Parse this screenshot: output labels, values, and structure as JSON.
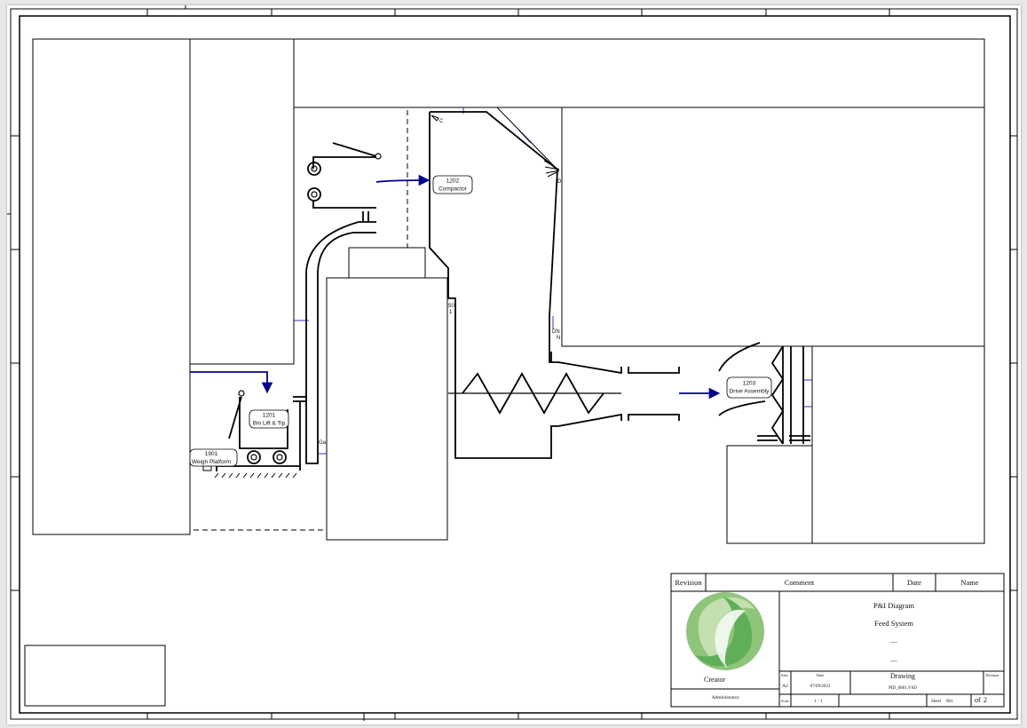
{
  "equipment": {
    "compactor": {
      "tag": "1202",
      "name": "Compactor"
    },
    "bin_lift": {
      "tag": "1201",
      "name": "Bin Lift & Tip"
    },
    "weigh_platform": {
      "tag": "1901",
      "name": "Weigh Platform"
    },
    "drive_assembly": {
      "tag": "1203",
      "name": "Drive Assembly"
    }
  },
  "fragments": {
    "frag_50": "50",
    "frag_1": "1",
    "frag_dn": "DN",
    "frag_n": "N",
    "frag_ga": "Ga",
    "frag_c": "C",
    "frag_d": "D"
  },
  "title_block": {
    "headers": {
      "revision": "Revision",
      "comment": "Comment",
      "date": "Date",
      "name": "Name"
    },
    "title_line1": "P&I Diagram",
    "title_line2": "Feed System",
    "title_line3": "----",
    "title_line4": "----",
    "creator_label": "Creator",
    "creator_name": "Administrator",
    "size_label": "Size",
    "size_value": "A2",
    "date_label": "Date",
    "date_value": "07/09/2023",
    "drawing_label": "Drawing",
    "drawing_value": "PID_0001.VSD",
    "revision_label": "Revision",
    "scale_label": "Scale",
    "scale_value": "1 : 1",
    "sheet_label": "Sheet",
    "sheet_value": "001",
    "of_label": "of",
    "of_value": "2"
  },
  "colors": {
    "flow_arrow": "#00008b",
    "line": "#000000",
    "logo_light": "#a8d08d",
    "logo_dark": "#5fae5a"
  }
}
